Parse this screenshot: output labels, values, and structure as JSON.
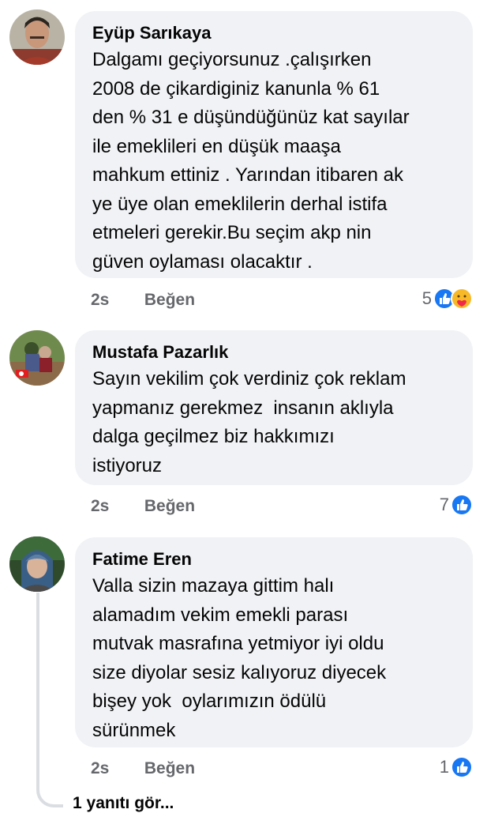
{
  "comments": [
    {
      "author": "Eyüp Sarıkaya",
      "text": "Dalgamı geçiyorsunuz .çalışırken\n2008 de çikardiginiz kanunla % 61\nden % 31 e düşündüğünüz kat sayılar\nile emeklileri en düşük maaşa\nmahkum ettiniz . Yarından itibaren ak\nye üye olan emeklilerin derhal istifa\netmeleri gerekir.Bu seçim akp nin\ngüven oylaması olacaktır .",
      "time": "2s",
      "like_label": "Beğen",
      "reaction_count": "5",
      "reactions": [
        "like-icon",
        "care-icon"
      ]
    },
    {
      "author": "Mustafa Pazarlık",
      "text": "Sayın vekilim çok verdiniz çok reklam\nyapmanız gerekmez  insanın aklıyla\ndalga geçilmez biz hakkımızı\nistiyoruz",
      "time": "2s",
      "like_label": "Beğen",
      "reaction_count": "7",
      "reactions": [
        "like-icon"
      ]
    },
    {
      "author": "Fatime Eren",
      "text": "Valla sizin mazaya gittim halı\nalamadım vekim emekli parası\nmutvak masrafına yetmiyor iyi oldu\nsize diyolar sesiz kalıyoruz diyecek\nbişey yok  oylarımızın ödülü\nsürünmek",
      "time": "2s",
      "like_label": "Beğen",
      "reaction_count": "1",
      "reactions": [
        "like-icon"
      ]
    }
  ],
  "replies_link": "1 yanıtı gör...",
  "colors": {
    "bubble": "#f0f2f5",
    "meta": "#65676b",
    "like_blue": "#1877f2",
    "care_yellow": "#f7b928"
  }
}
